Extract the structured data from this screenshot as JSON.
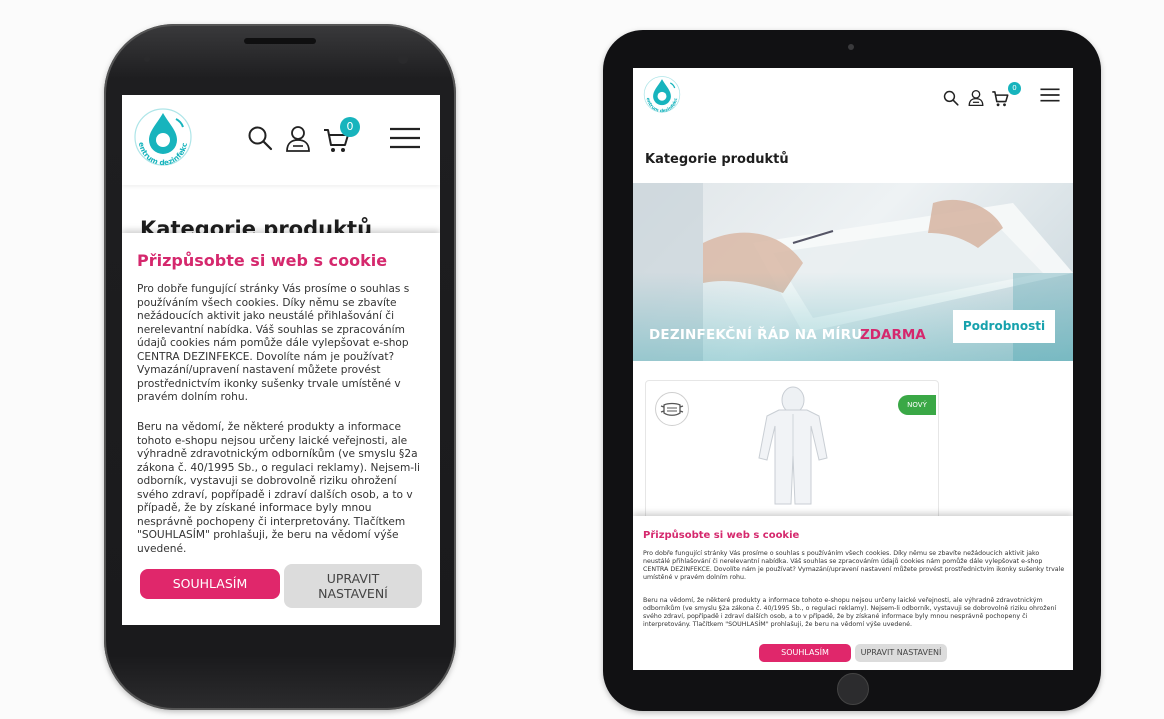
{
  "colors": {
    "accent_teal": "#17b4bd",
    "cookie_title_pink": "#d5286d",
    "agree_button_pink": "#e0276b",
    "settings_button_gray": "#dcdcdc",
    "new_badge_green": "#3aa846"
  },
  "icons": {
    "header": [
      "logo-icon",
      "search-icon",
      "user-icon",
      "cart-icon",
      "menu-icon"
    ],
    "product": [
      "mask-icon"
    ]
  },
  "phone": {
    "logo_text": "centrum dezinfekce",
    "cart_count": "0",
    "page_heading": "Kategorie produktů",
    "cookie": {
      "title": "Přizpůsobte si web s cookie",
      "paragraph1": "Pro dobře fungující stránky Vás prosíme o souhlas s používáním všech cookies. Díky němu se zbavíte nežádoucích aktivit jako neustálé přihlašování či nerelevantní nabídka. Váš souhlas se zpracováním údajů cookies nám pomůže dále vylepšovat e-shop CENTRA DEZINFEKCE. Dovolíte nám je používat? Vymazání/upravení nastavení můžete provést prostřednictvím ikonky sušenky trvale umístěné v pravém dolním rohu.",
      "paragraph2": "Beru na vědomí, že některé produkty a informace tohoto e-shopu nejsou určeny laické veřejnosti, ale výhradně zdravotnickým odborníkům (ve smyslu §2a zákona č. 40/1995 Sb., o regulaci reklamy). Nejsem-li odborník, vystavuji se dobrovolně riziku ohrožení svého zdraví, popřípadě i zdraví dalších osob, a to v případě, že by získané informace byly mnou nesprávně pochopeny či interpretovány. Tlačítkem \"SOUHLASÍM\" prohlašuji, že beru na vědomí výše uvedené.",
      "agree_label": "SOUHLASÍM",
      "settings_label": "UPRAVIT NASTAVENÍ"
    }
  },
  "tablet": {
    "logo_text": "centrum dezinfekce",
    "cart_count": "0",
    "page_heading": "Kategorie produktů",
    "banner": {
      "text_main": "DEZINFEKČNÍ ŘÁD NA MÍRU",
      "text_highlight": "ZDARMA",
      "button_label": "Podrobnosti"
    },
    "product": {
      "badge": "NOVÝ"
    },
    "cookie": {
      "title": "Přizpůsobte si web s cookie",
      "paragraph1": "Pro dobře fungující stránky Vás prosíme o souhlas s používáním všech cookies. Díky němu se zbavíte nežádoucích aktivit jako neustálé přihlašování či nerelevantní nabídka. Váš souhlas se zpracováním údajů cookies nám pomůže dále vylepšovat e-shop CENTRA DEZINFEKCE. Dovolíte nám je používat? Vymazání/upravení nastavení můžete provést prostřednictvím ikonky sušenky trvale umístěné v pravém dolním rohu.",
      "paragraph2": "Beru na vědomí, že některé produkty a informace tohoto e-shopu nejsou určeny laické veřejnosti, ale výhradně zdravotnickým odborníkům (ve smyslu §2a zákona č. 40/1995 Sb., o regulaci reklamy). Nejsem-li odborník, vystavuji se dobrovolně riziku ohrožení svého zdraví, popřípadě i zdraví dalších osob, a to v případě, že by získané informace byly mnou nesprávně pochopeny či interpretovány. Tlačítkem \"SOUHLASÍM\" prohlašuji, že beru na vědomí výše uvedené.",
      "agree_label": "SOUHLASÍM",
      "settings_label": "UPRAVIT NASTAVENÍ"
    }
  }
}
